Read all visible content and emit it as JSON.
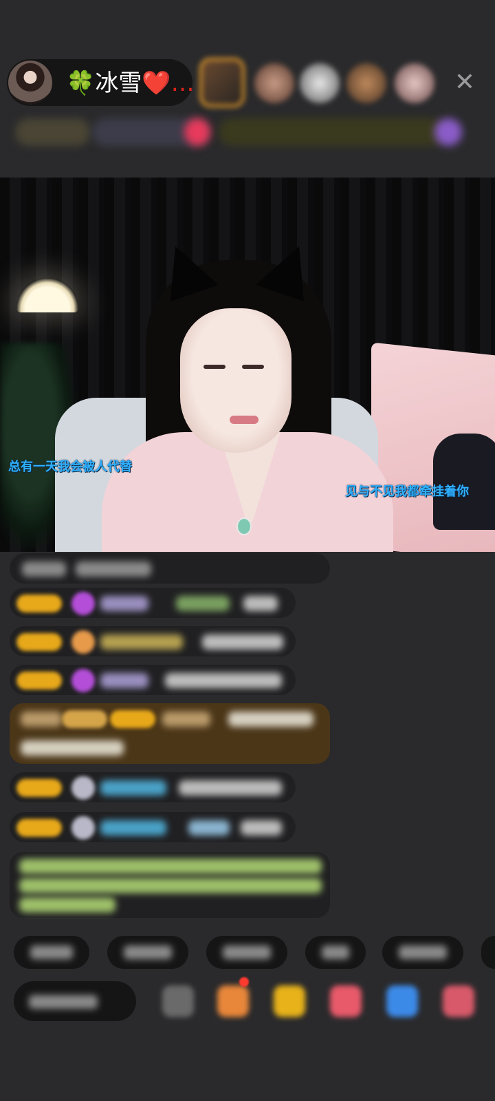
{
  "header": {
    "host_name_prefix": "🍀",
    "host_name": "冰雪",
    "host_name_suffix": "❤️…",
    "close_glyph": "✕",
    "viewer_count": 5
  },
  "video": {
    "subtitle_left": "总有一天我会被人代替",
    "subtitle_right": "见与不见我都牵挂着你"
  },
  "colors": {
    "subtitle": "#2fb0ff",
    "badge": "#e7a81a",
    "background": "#2a2a2c"
  },
  "icons": [
    "close-icon",
    "gift-box-icon",
    "red-packet-icon",
    "heart-icon",
    "game-icon",
    "shop-icon",
    "emoji-icon"
  ]
}
